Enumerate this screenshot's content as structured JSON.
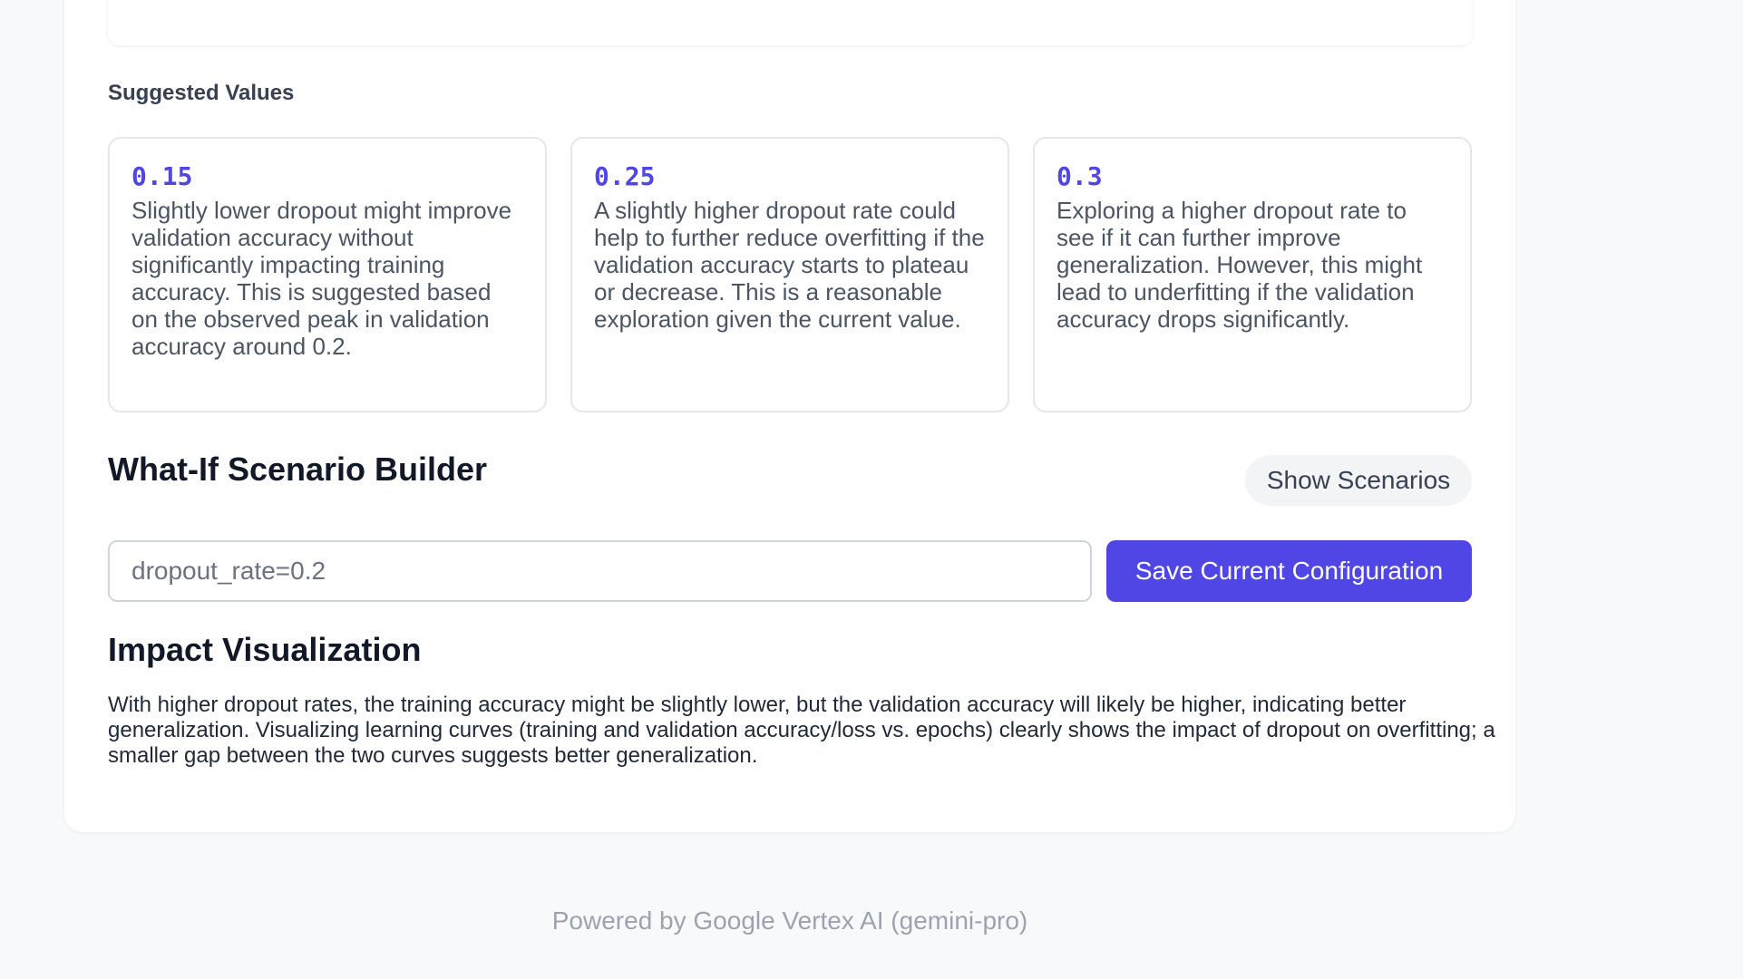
{
  "suggested_values": {
    "heading": "Suggested Values",
    "items": [
      {
        "value": "0.15",
        "description": "Slightly lower dropout might improve validation accuracy without significantly impacting training accuracy. This is suggested based on the observed peak in validation accuracy around 0.2."
      },
      {
        "value": "0.25",
        "description": "A slightly higher dropout rate could help to further reduce overfitting if the validation accuracy starts to plateau or decrease. This is a reasonable exploration given the current value."
      },
      {
        "value": "0.3",
        "description": "Exploring a higher dropout rate to see if it can further improve generalization. However, this might lead to underfitting if the validation accuracy drops significantly."
      }
    ]
  },
  "scenario_builder": {
    "title": "What-If Scenario Builder",
    "show_scenarios_label": "Show Scenarios",
    "input_value": "dropout_rate=0.2",
    "save_label": "Save Current Configuration"
  },
  "impact": {
    "title": "Impact Visualization",
    "text": "With higher dropout rates, the training accuracy might be slightly lower, but the validation accuracy will likely be higher, indicating better generalization. Visualizing learning curves (training and validation accuracy/loss vs. epochs) clearly shows the impact of dropout on overfitting; a smaller gap between the two curves suggests better generalization."
  },
  "footer": {
    "text": "Powered by Google Vertex AI (gemini-pro)"
  },
  "colors": {
    "accent": "#4f46e5",
    "page_background": "#f8f9fb",
    "card_background": "#ffffff"
  }
}
